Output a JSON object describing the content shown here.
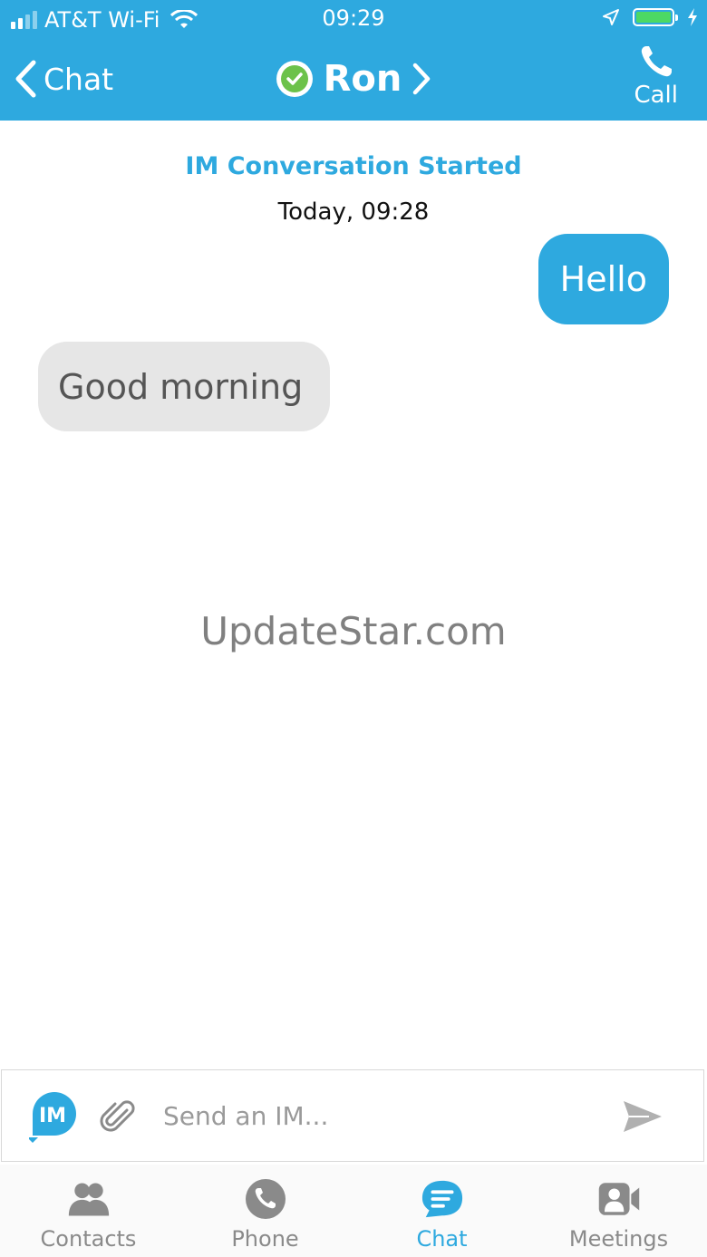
{
  "status_bar": {
    "carrier": "AT&T Wi-Fi",
    "time": "09:29",
    "battery_color": "#4cd964"
  },
  "nav": {
    "back_label": "Chat",
    "contact_name": "Ron",
    "call_label": "Call",
    "presence_color": "#6cc24a"
  },
  "conversation": {
    "started_label": "IM Conversation Started",
    "started_time": "Today, 09:28",
    "messages": [
      {
        "direction": "outgoing",
        "text": "Hello"
      },
      {
        "direction": "incoming",
        "text": "Good morning"
      }
    ]
  },
  "watermark": "UpdateStar.com",
  "composer": {
    "badge_label": "IM",
    "placeholder": "Send an IM...",
    "value": ""
  },
  "tabs": [
    {
      "label": "Contacts",
      "icon": "contacts-icon",
      "active": false
    },
    {
      "label": "Phone",
      "icon": "phone-icon",
      "active": false
    },
    {
      "label": "Chat",
      "icon": "chat-icon",
      "active": true
    },
    {
      "label": "Meetings",
      "icon": "meetings-icon",
      "active": false
    }
  ],
  "colors": {
    "accent": "#2ea9df",
    "incoming_bubble": "#e6e6e6",
    "inactive_tab": "#8a8a8a"
  }
}
